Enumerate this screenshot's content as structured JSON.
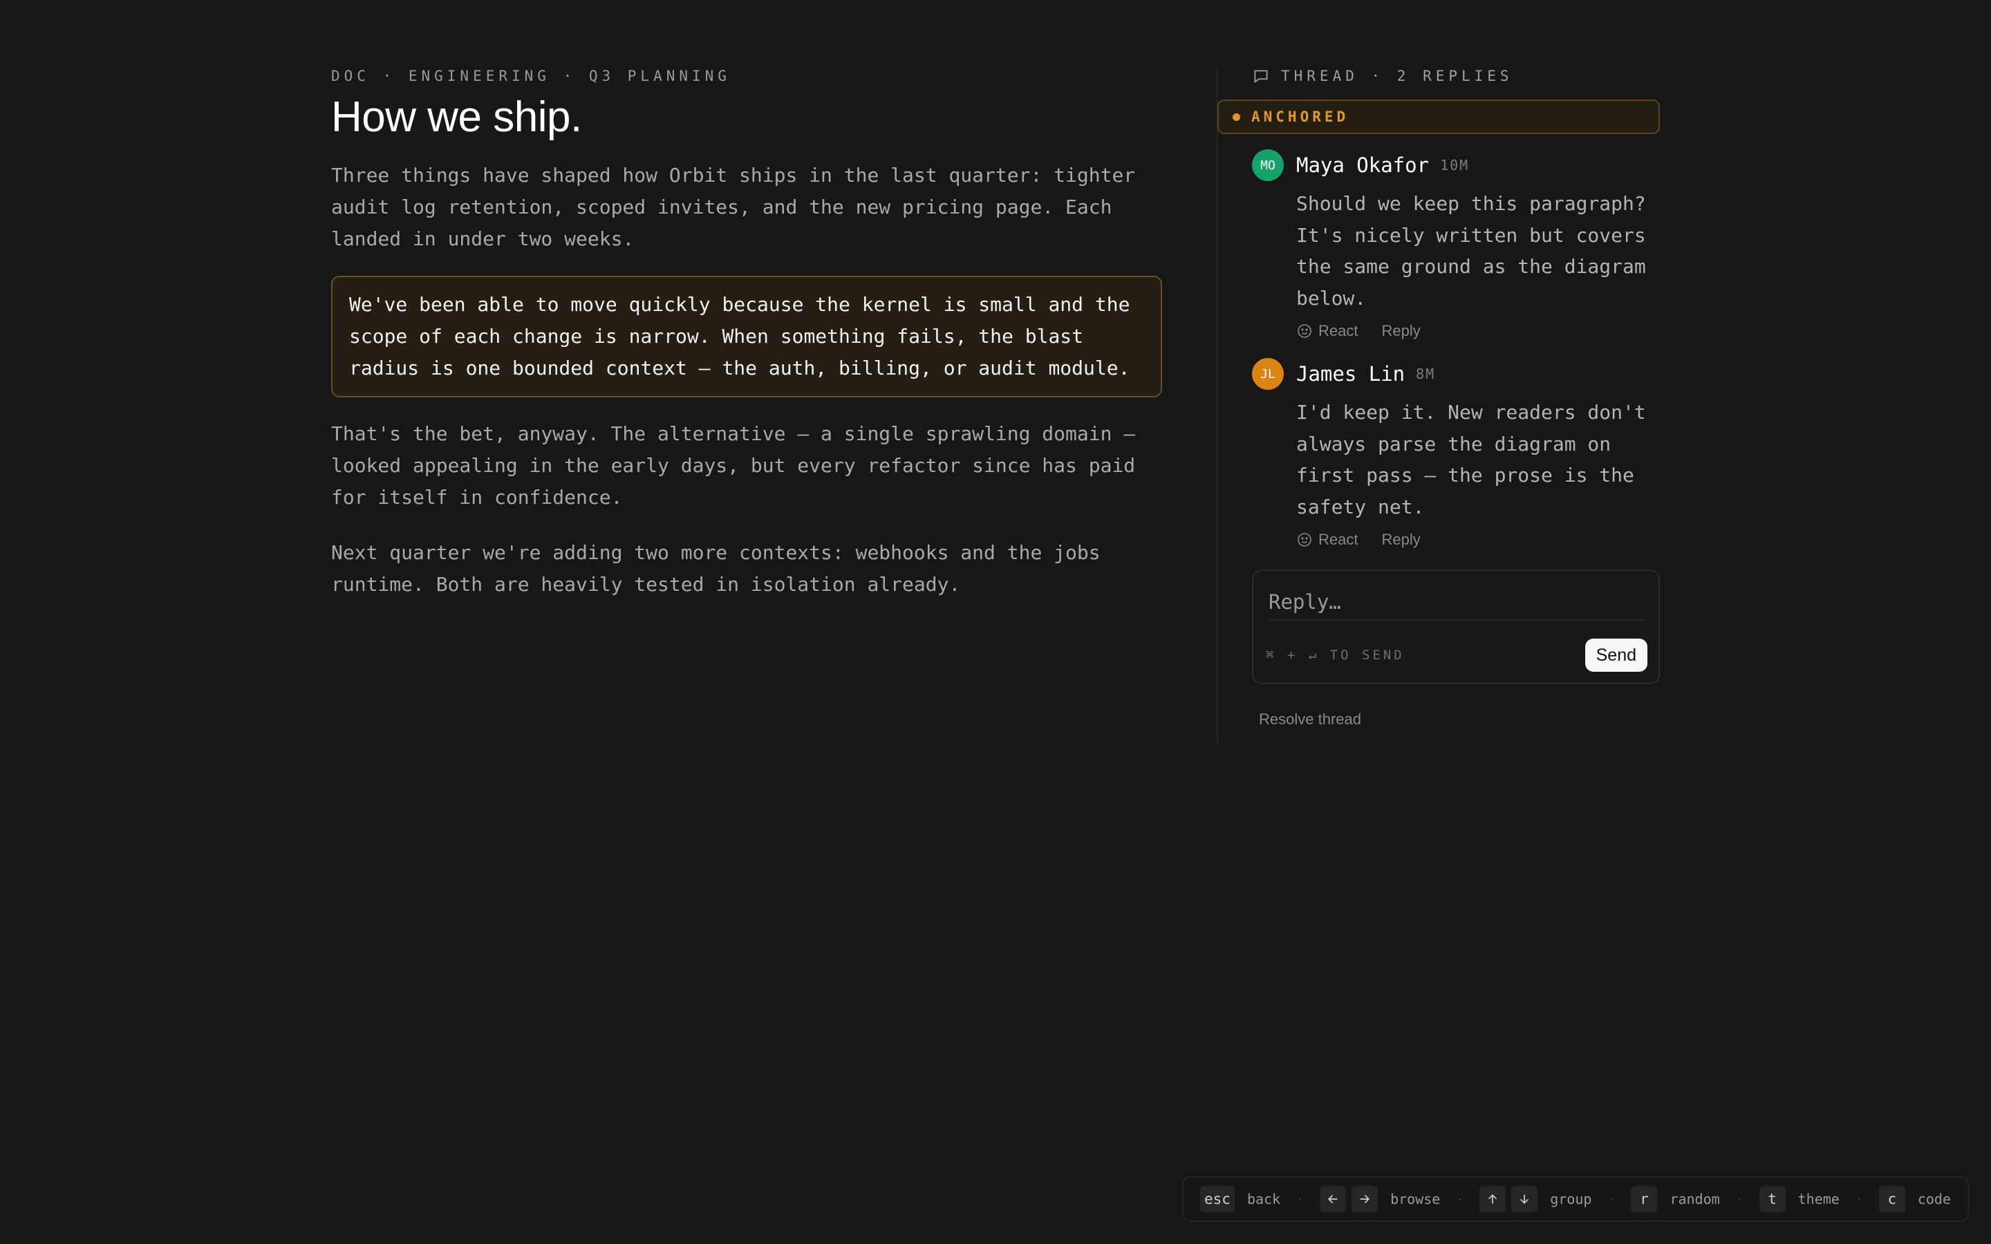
{
  "doc": {
    "breadcrumb": "DOC · ENGINEERING · Q3 PLANNING",
    "title": "How we ship.",
    "paragraphs": [
      "Three things have shaped how Orbit ships in the last quarter: tighter audit log retention, scoped invites, and the new pricing page. Each landed in under two weeks.",
      "We've been able to move quickly because the kernel is small and the scope of each change is narrow. When something fails, the blast radius is one bounded context — the auth, billing, or audit module.",
      "That's the bet, anyway. The alternative — a single sprawling domain — looked appealing in the early days, but every refactor since has paid for itself in confidence.",
      "Next quarter we're adding two more contexts: webhooks and the jobs runtime. Both are heavily tested in isolation already."
    ]
  },
  "thread": {
    "header": "THREAD · 2 REPLIES",
    "icon": "comment-icon",
    "anchored_label": "ANCHORED",
    "comments": [
      {
        "initials": "MO",
        "author": "Maya Okafor",
        "time": "10M",
        "avatar_color": "#14a36b",
        "body": "Should we keep this paragraph? It's nicely written but covers the same ground as the diagram below.",
        "react_label": "React",
        "reply_label": "Reply"
      },
      {
        "initials": "JL",
        "author": "James Lin",
        "time": "8M",
        "avatar_color": "#dc8412",
        "body": "I'd keep it. New readers don't always parse the diagram on first pass — the prose is the safety net.",
        "react_label": "React",
        "reply_label": "Reply"
      }
    ],
    "reply_placeholder": "Reply…",
    "send_hint": "⌘ + ↵ TO SEND",
    "send_label": "Send",
    "resolve_label": "Resolve thread"
  },
  "shortcuts": {
    "back": {
      "key": "esc",
      "label": "back"
    },
    "browse": {
      "label": "browse"
    },
    "group": {
      "label": "group"
    },
    "random": {
      "key": "r",
      "label": "random"
    },
    "theme": {
      "key": "t",
      "label": "theme"
    },
    "code": {
      "key": "c",
      "label": "code"
    },
    "separator": "·"
  },
  "colors": {
    "background": "#171717",
    "accent": "#e09a1f",
    "highlight_border": "#6b5120"
  }
}
